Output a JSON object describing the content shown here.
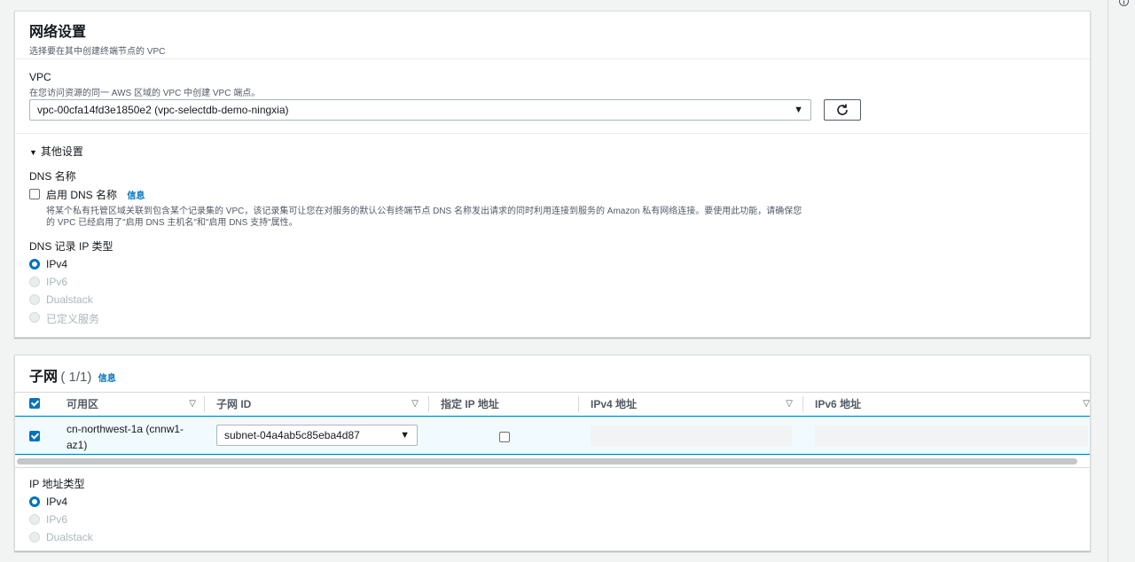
{
  "network": {
    "title": "网络设置",
    "subtitle": "选择要在其中创建终端节点的 VPC",
    "vpc_label": "VPC",
    "vpc_desc": "在您访问资源的同一 AWS 区域的 VPC 中创建 VPC 端点。",
    "vpc_selected": "vpc-00cfa14fd3e1850e2 (vpc-selectdb-demo-ningxia)",
    "other_settings": "其他设置",
    "dns_name_label": "DNS 名称",
    "enable_dns_label": "启用 DNS 名称",
    "info": "信息",
    "enable_dns_desc_1": "将某个私有托管区域关联到包含某个记录集的 VPC，该记录集可让您在对服务的默认公有终端节点 DNS 名称发出请求的同时利用连接到服务的 Amazon 私有网络连接。要使用此功能，请确保您",
    "enable_dns_desc_2": "的 VPC 已经启用了\"启用 DNS 主机名\"和\"启用 DNS 支持\"属性。",
    "dns_ip_type_label": "DNS 记录 IP 类型",
    "dns_ip_options": [
      "IPv4",
      "IPv6",
      "Dualstack",
      "已定义服务"
    ]
  },
  "subnets": {
    "title": "子网",
    "count": "( 1/1)",
    "info": "信息",
    "columns": [
      "可用区",
      "子网 ID",
      "指定 IP 地址",
      "IPv4 地址",
      "IPv6 地址"
    ],
    "row": {
      "az_line1": "cn-northwest-1a (cnnw1-",
      "az_line2": "az1)",
      "subnet_id": "subnet-04a4ab5c85eba4d87"
    },
    "ip_type_label": "IP 地址类型",
    "ip_options": [
      "IPv4",
      "IPv6",
      "Dualstack"
    ]
  },
  "colors": {
    "accent": "#0073bb",
    "border": "#d5dbdb",
    "page_bg": "#f2f3f3"
  },
  "icons": [
    "refresh-icon",
    "caret-down-icon",
    "sort-icon",
    "info-icon"
  ]
}
